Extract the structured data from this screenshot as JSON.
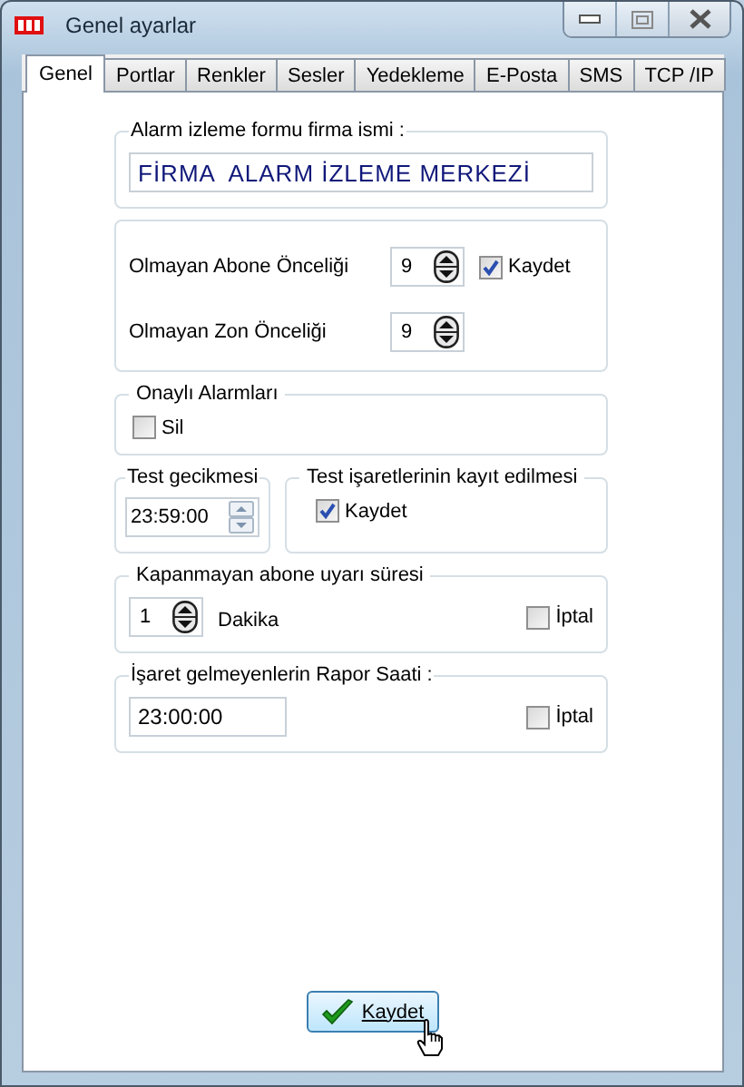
{
  "window": {
    "title": "Genel ayarlar"
  },
  "tabs": [
    {
      "label": "Genel",
      "selected": true
    },
    {
      "label": "Portlar",
      "selected": false
    },
    {
      "label": "Renkler",
      "selected": false
    },
    {
      "label": "Sesler",
      "selected": false
    },
    {
      "label": "Yedekleme",
      "selected": false
    },
    {
      "label": "E-Posta",
      "selected": false
    },
    {
      "label": "SMS",
      "selected": false
    },
    {
      "label": "TCP /IP",
      "selected": false
    }
  ],
  "sections": [
    [
      {
        "legend": "Alarm izleme formu firma ismi :",
        "rows": [
          [
            {
              "kind": "field",
              "value": "FİRMA  ALARM İZLEME MERKEZİ"
            }
          ]
        ]
      }
    ],
    [
      {
        "rows": [
          [
            {
              "kind": "label",
              "text": "Olmayan Abone Önceliği"
            },
            {
              "kind": "spinner",
              "value": "9"
            },
            {
              "kind": "checkbox",
              "label": "Kaydet",
              "checked": true
            }
          ],
          [
            {
              "kind": "label",
              "text": "Olmayan Zon Önceliği"
            },
            {
              "kind": "spinner",
              "value": "9"
            }
          ]
        ]
      }
    ],
    [
      {
        "legend": "Onaylı Alarmları",
        "rows": [
          [
            {
              "kind": "checkbox",
              "label": "Sil",
              "checked": false
            }
          ]
        ]
      }
    ],
    [
      {
        "legend": "Test gecikmesi",
        "rows": [
          [
            {
              "kind": "timespinner",
              "value": "23:59:00"
            }
          ]
        ]
      },
      {
        "legend": "Test işaretlerinin kayıt edilmesi",
        "rows": [
          [
            {
              "kind": "checkbox",
              "label": "Kaydet",
              "checked": true
            }
          ]
        ]
      }
    ],
    [
      {
        "legend": "Kapanmayan abone uyarı süresi",
        "rows": [
          [
            {
              "kind": "spinner",
              "value": "1"
            },
            {
              "kind": "label",
              "text": "Dakika"
            },
            {
              "kind": "checkbox",
              "label": "İptal",
              "checked": false
            }
          ]
        ]
      }
    ],
    [
      {
        "legend": "İşaret gelmeyenlerin Rapor Saati :",
        "rows": [
          [
            {
              "kind": "field",
              "value": "23:00:00"
            },
            {
              "kind": "checkbox",
              "label": "İptal",
              "checked": false
            }
          ]
        ]
      }
    ]
  ],
  "save_button": {
    "label": "Kaydet"
  }
}
